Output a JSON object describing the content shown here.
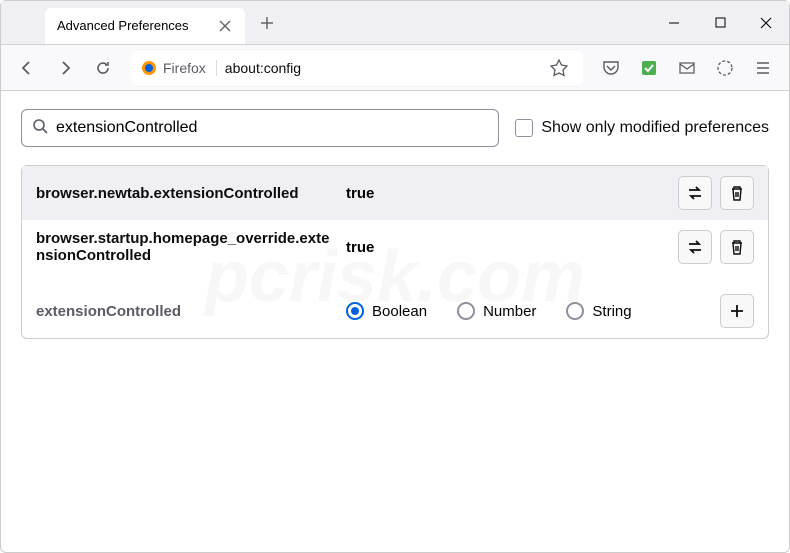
{
  "tab": {
    "title": "Advanced Preferences"
  },
  "urlbar": {
    "identity": "Firefox",
    "url": "about:config"
  },
  "search": {
    "value": "extensionControlled",
    "checkbox_label": "Show only modified preferences"
  },
  "prefs": [
    {
      "name": "browser.newtab.extensionControlled",
      "value": "true"
    },
    {
      "name": "browser.startup.homepage_override.extensionControlled",
      "value": "true"
    }
  ],
  "new_pref": {
    "name": "extensionControlled",
    "types": [
      "Boolean",
      "Number",
      "String"
    ],
    "selected": 0
  },
  "watermark": "pcrisk.com"
}
